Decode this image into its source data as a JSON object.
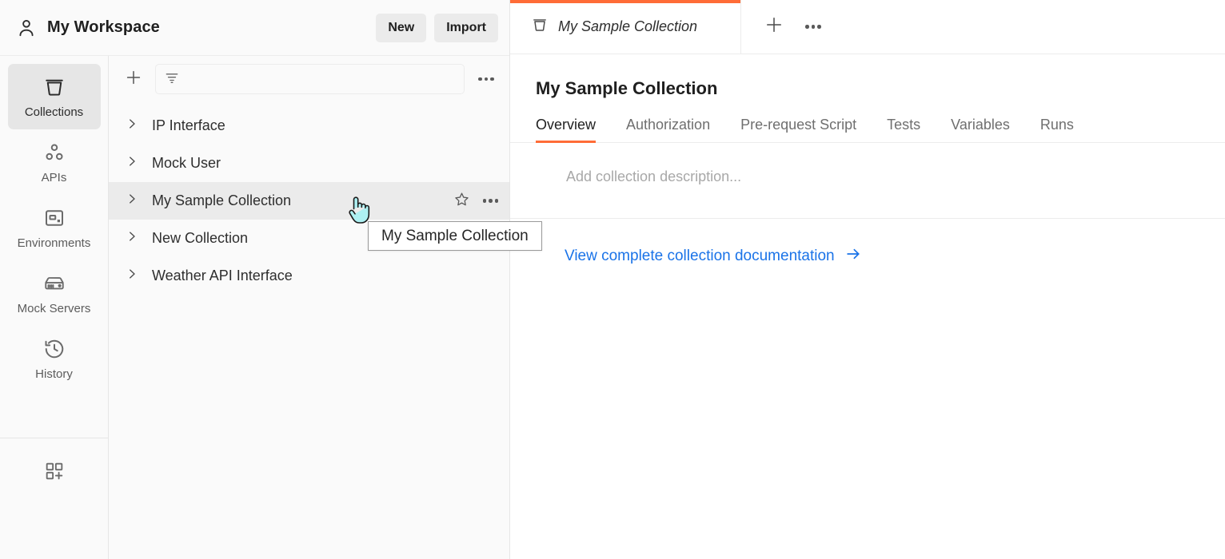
{
  "workspace": {
    "avatar_icon": "user-icon",
    "title": "My Workspace",
    "new_label": "New",
    "import_label": "Import"
  },
  "rail": {
    "items": [
      {
        "label": "Collections",
        "icon": "collection-icon",
        "active": true
      },
      {
        "label": "APIs",
        "icon": "apis-icon",
        "active": false
      },
      {
        "label": "Environments",
        "icon": "environments-icon",
        "active": false
      },
      {
        "label": "Mock Servers",
        "icon": "mock-servers-icon",
        "active": false
      },
      {
        "label": "History",
        "icon": "history-icon",
        "active": false
      }
    ],
    "bottom_icon": "new-module-icon"
  },
  "collections_panel": {
    "add_icon": "plus-icon",
    "filter_icon": "filter-icon",
    "filter_placeholder": "",
    "filter_value": "",
    "more_icon": "more-options-icon",
    "items": [
      {
        "name": "IP Interface",
        "hovered": false
      },
      {
        "name": "Mock User",
        "hovered": false
      },
      {
        "name": "My Sample Collection",
        "hovered": true
      },
      {
        "name": "New Collection",
        "hovered": false
      },
      {
        "name": "Weather API Interface",
        "hovered": false
      }
    ],
    "star_icon": "star-icon",
    "row_more_icon": "more-options-icon"
  },
  "tooltip": {
    "text": "My Sample Collection"
  },
  "cursor": {
    "icon": "pointing-hand-cursor"
  },
  "tabbar": {
    "tabs": [
      {
        "label": "My Sample Collection",
        "icon": "collection-icon",
        "active": true
      }
    ],
    "new_tab_icon": "plus-icon",
    "more_icon": "more-options-icon"
  },
  "main": {
    "collection_title": "My Sample Collection",
    "sub_tabs": [
      {
        "label": "Overview",
        "active": true
      },
      {
        "label": "Authorization",
        "active": false
      },
      {
        "label": "Pre-request Script",
        "active": false
      },
      {
        "label": "Tests",
        "active": false
      },
      {
        "label": "Variables",
        "active": false
      },
      {
        "label": "Runs",
        "active": false
      }
    ],
    "description_placeholder": "Add collection description...",
    "doc_link_label": "View complete collection documentation",
    "doc_link_arrow_icon": "arrow-right-icon"
  },
  "colors": {
    "accent": "#ff6c37",
    "link": "#1a73e8",
    "hover_row": "#ebebeb",
    "panel_bg": "#fafafa",
    "border": "#ececec"
  }
}
